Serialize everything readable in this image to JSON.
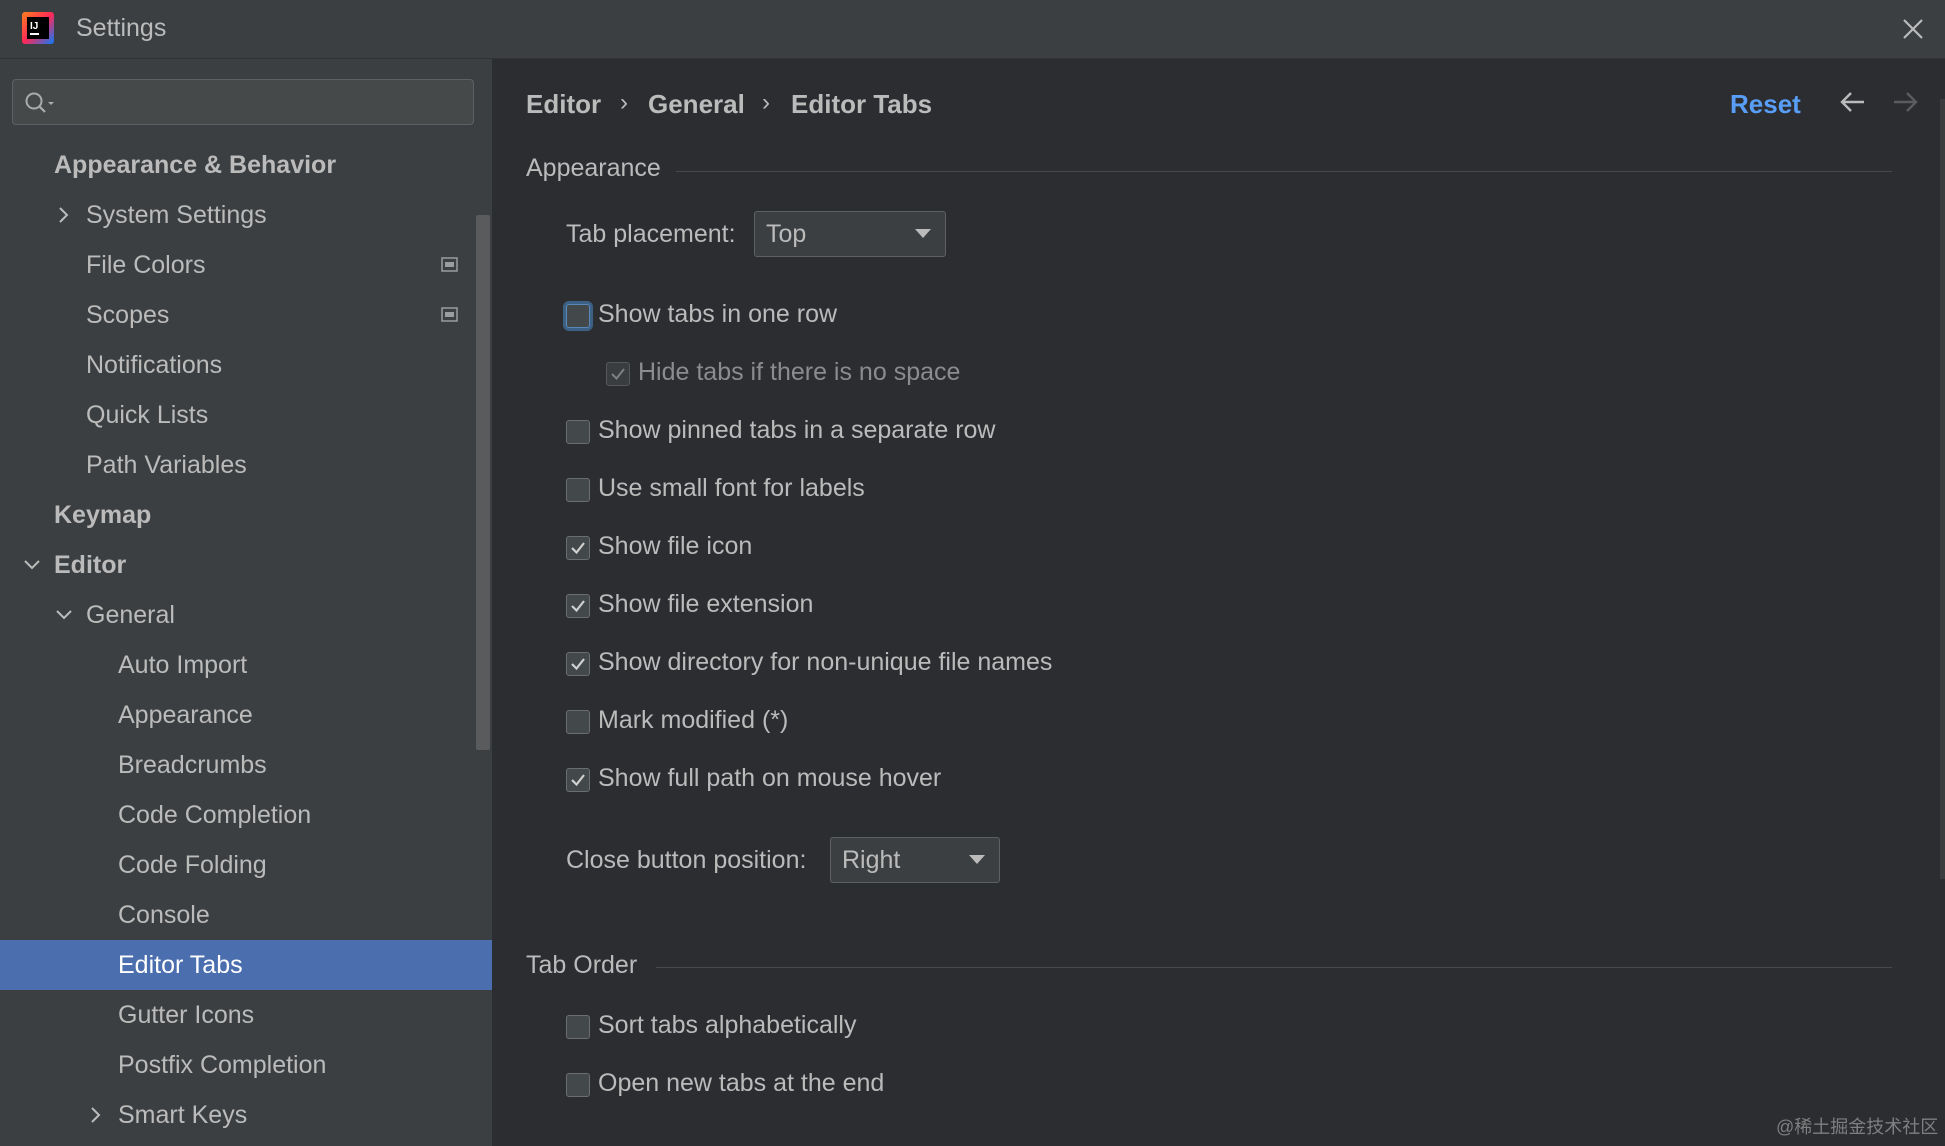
{
  "window": {
    "title": "Settings",
    "app_icon_label": "IJ"
  },
  "sidebar": {
    "search": {
      "value": "",
      "placeholder": ""
    },
    "items": [
      {
        "label": "Appearance & Behavior"
      },
      {
        "label": "System Settings"
      },
      {
        "label": "File Colors"
      },
      {
        "label": "Scopes"
      },
      {
        "label": "Notifications"
      },
      {
        "label": "Quick Lists"
      },
      {
        "label": "Path Variables"
      },
      {
        "label": "Keymap"
      },
      {
        "label": "Editor"
      },
      {
        "label": "General"
      },
      {
        "label": "Auto Import"
      },
      {
        "label": "Appearance"
      },
      {
        "label": "Breadcrumbs"
      },
      {
        "label": "Code Completion"
      },
      {
        "label": "Code Folding"
      },
      {
        "label": "Console"
      },
      {
        "label": "Editor Tabs"
      },
      {
        "label": "Gutter Icons"
      },
      {
        "label": "Postfix Completion"
      },
      {
        "label": "Smart Keys"
      }
    ],
    "selected": "Editor Tabs"
  },
  "header": {
    "breadcrumb": [
      "Editor",
      "General",
      "Editor Tabs"
    ],
    "separator": "›",
    "reset_label": "Reset"
  },
  "appearance_section": {
    "title": "Appearance",
    "tab_placement": {
      "label": "Tab placement:",
      "value": "Top"
    },
    "options": [
      {
        "label": "Show tabs in one row",
        "checked": false,
        "focused": true
      },
      {
        "label": "Hide tabs if there is no space",
        "checked": true,
        "disabled": true
      },
      {
        "label": "Show pinned tabs in a separate row",
        "checked": false
      },
      {
        "label": "Use small font for labels",
        "checked": false
      },
      {
        "label": "Show file icon",
        "checked": true
      },
      {
        "label": "Show file extension",
        "checked": true
      },
      {
        "label": "Show directory for non-unique file names",
        "checked": true
      },
      {
        "label": "Mark modified (*)",
        "checked": false
      },
      {
        "label": "Show full path on mouse hover",
        "checked": true
      }
    ],
    "close_button_position": {
      "label": "Close button position:",
      "value": "Right"
    }
  },
  "tab_order_section": {
    "title": "Tab Order",
    "options": [
      {
        "label": "Sort tabs alphabetically",
        "checked": false
      },
      {
        "label": "Open new tabs at the end",
        "checked": false
      }
    ]
  },
  "watermark": "@稀土掘金技术社区",
  "colors": {
    "accent": "#589df6",
    "selection": "#4b6eaf",
    "panel": "#3c3f41",
    "content": "#2b2d30"
  }
}
